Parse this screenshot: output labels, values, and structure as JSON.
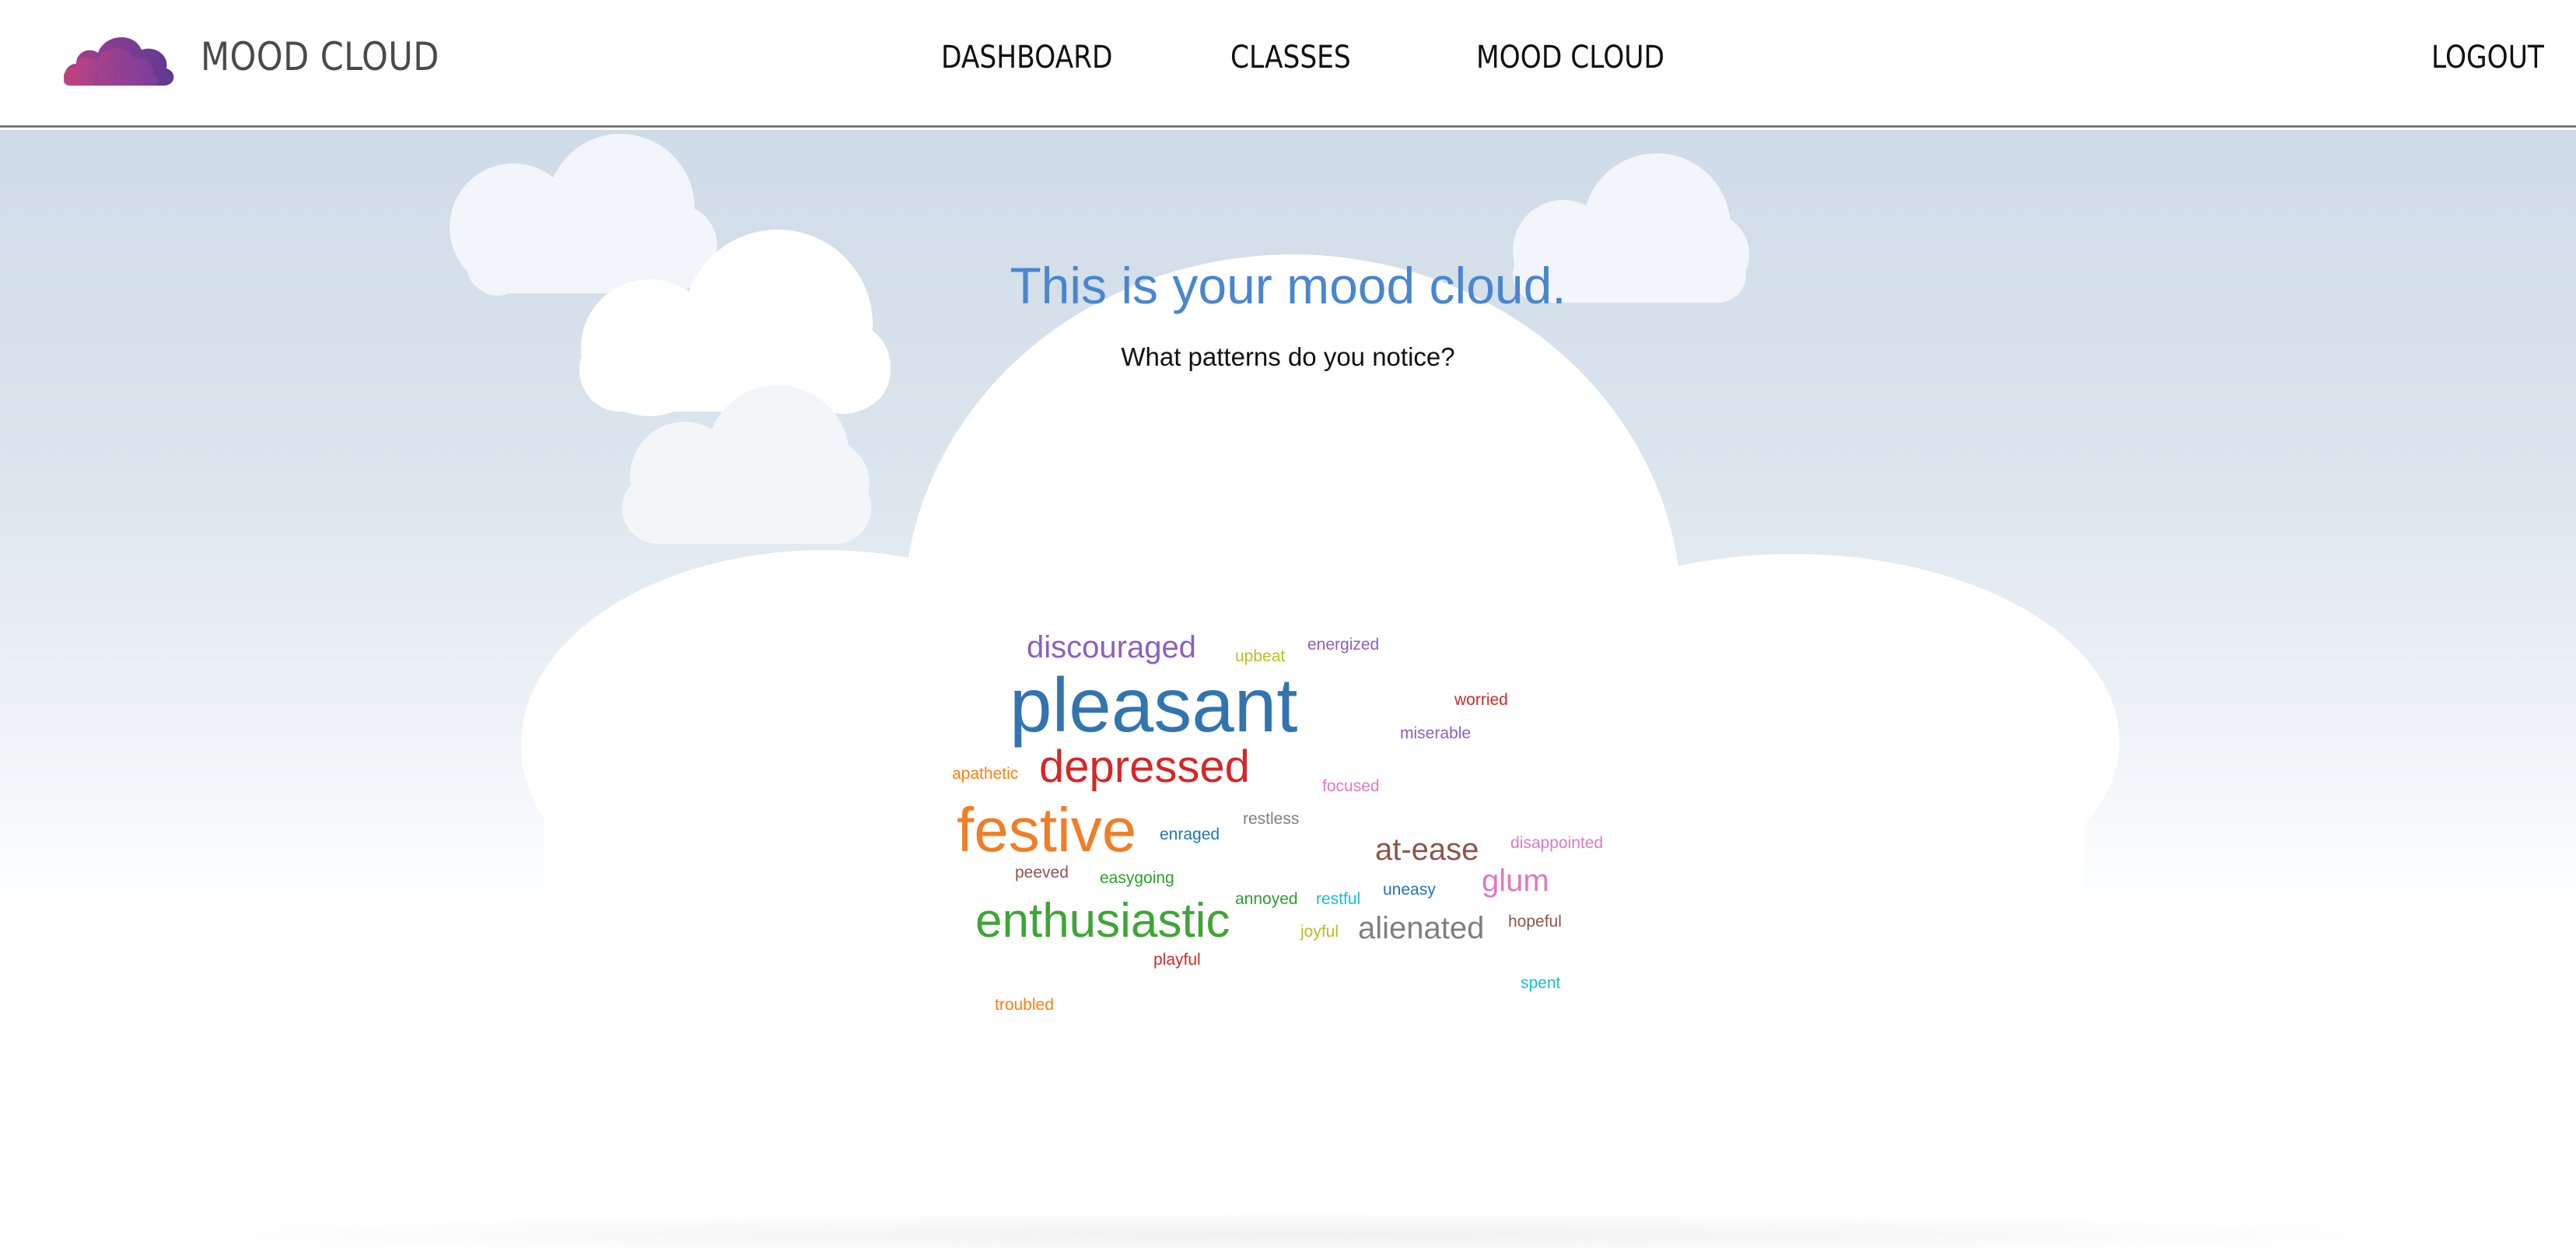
{
  "header": {
    "brand": "MOOD CLOUD",
    "nav": [
      {
        "label": "DASHBOARD"
      },
      {
        "label": "CLASSES"
      },
      {
        "label": "MOOD CLOUD"
      }
    ],
    "logout": "LOGOUT"
  },
  "hero": {
    "title": "This is your mood cloud.",
    "subtitle": "What patterns do you notice?"
  },
  "word_cloud": {
    "words": [
      {
        "text": "discouraged",
        "color": "#8e5fbf"
      },
      {
        "text": "upbeat",
        "color": "#bcbd22"
      },
      {
        "text": "energized",
        "color": "#8e5fbf"
      },
      {
        "text": "pleasant",
        "color": "#3274b0"
      },
      {
        "text": "worried",
        "color": "#d62728"
      },
      {
        "text": "miserable",
        "color": "#8e5fbf"
      },
      {
        "text": "apathetic",
        "color": "#ff7f0e"
      },
      {
        "text": "depressed",
        "color": "#d62728"
      },
      {
        "text": "focused",
        "color": "#e377c2"
      },
      {
        "text": "festive",
        "color": "#f07e26"
      },
      {
        "text": "restless",
        "color": "#7f7f7f"
      },
      {
        "text": "enraged",
        "color": "#1f77b4"
      },
      {
        "text": "disappointed",
        "color": "#e377c2"
      },
      {
        "text": "at-ease",
        "color": "#8c564b"
      },
      {
        "text": "peeved",
        "color": "#8c564b"
      },
      {
        "text": "easygoing",
        "color": "#2ca02c"
      },
      {
        "text": "glum",
        "color": "#e377c2"
      },
      {
        "text": "uneasy",
        "color": "#1f77b4"
      },
      {
        "text": "annoyed",
        "color": "#2ca02c"
      },
      {
        "text": "restful",
        "color": "#17becf"
      },
      {
        "text": "enthusiastic",
        "color": "#3fa535"
      },
      {
        "text": "hopeful",
        "color": "#8c564b"
      },
      {
        "text": "joyful",
        "color": "#bcbd22"
      },
      {
        "text": "alienated",
        "color": "#7f7f7f"
      },
      {
        "text": "playful",
        "color": "#d62728"
      },
      {
        "text": "spent",
        "color": "#17becf"
      },
      {
        "text": "troubled",
        "color": "#ff7f0e"
      }
    ]
  }
}
